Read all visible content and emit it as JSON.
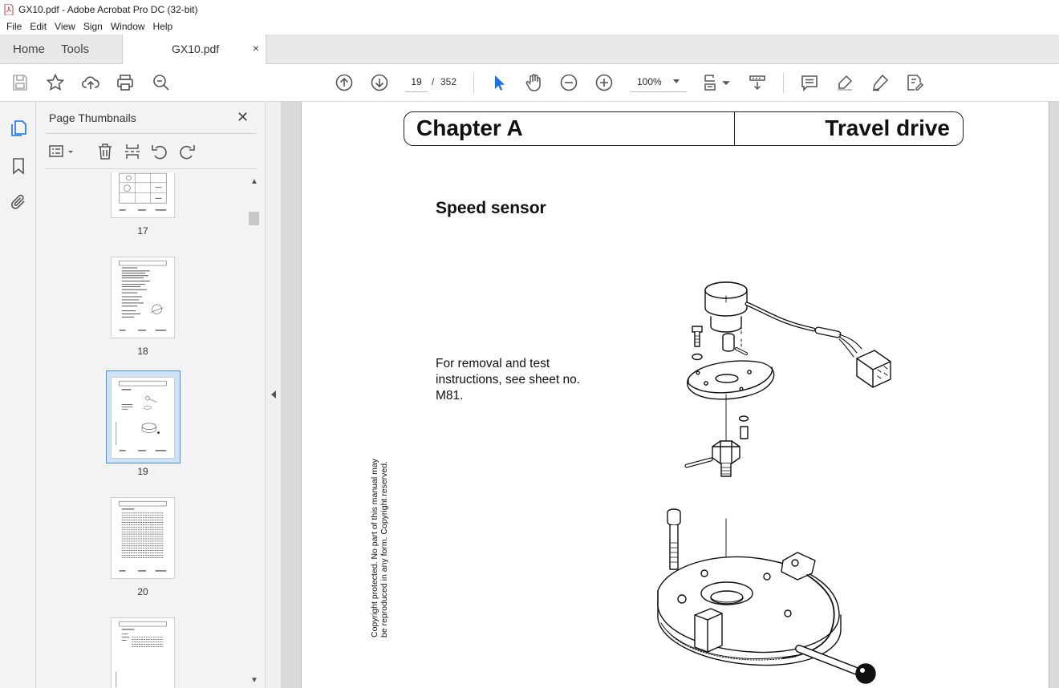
{
  "window": {
    "title": "GX10.pdf - Adobe Acrobat Pro DC (32-bit)"
  },
  "menu": [
    "File",
    "Edit",
    "View",
    "Sign",
    "Window",
    "Help"
  ],
  "tabs": {
    "home": "Home",
    "tools": "Tools",
    "document": "GX10.pdf",
    "close_glyph": "×"
  },
  "toolbar": {
    "current_page": "19",
    "page_separator": "/",
    "total_pages": "352",
    "zoom": "100%"
  },
  "panel": {
    "title": "Page Thumbnails",
    "close_glyph": "✕",
    "thumbnails": [
      {
        "label": "17"
      },
      {
        "label": "18"
      },
      {
        "label": "19",
        "selected": true
      },
      {
        "label": "20"
      }
    ]
  },
  "document": {
    "chapter": "Chapter A",
    "heading": "Travel drive",
    "section_title": "Speed sensor",
    "body": "For removal and test instructions, see sheet no. M81.",
    "copyright": "Copyright protected. No part of this manual may be reproduced in any form. Copyright reserved."
  },
  "colors": {
    "accent": "#1473e6",
    "selection": "#cfe2f7",
    "selection_border": "#4a90d9"
  }
}
